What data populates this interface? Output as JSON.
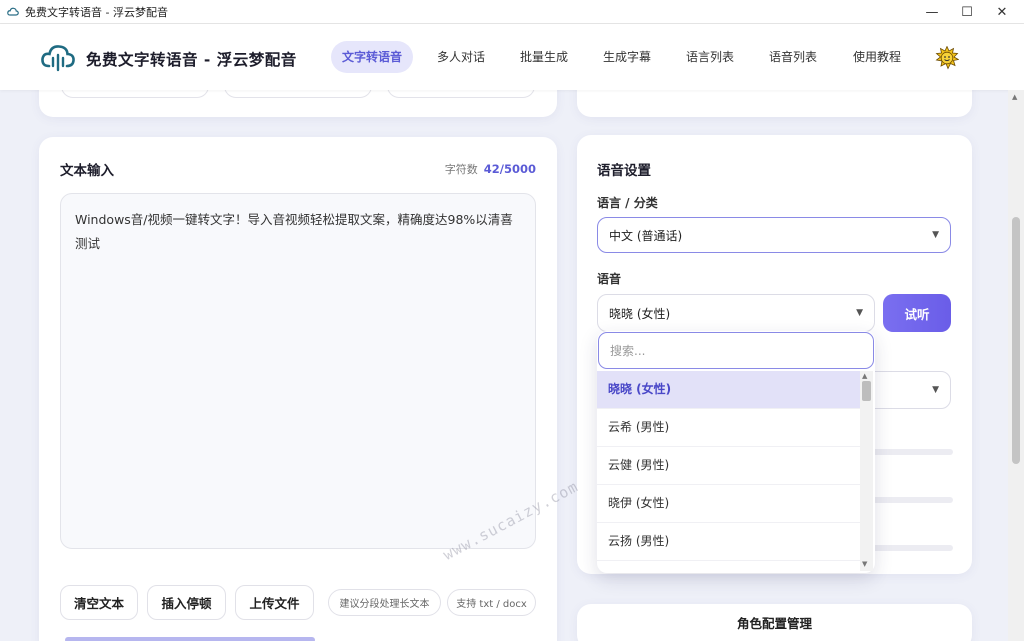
{
  "window": {
    "title": "免费文字转语音 - 浮云梦配音",
    "minimize": "—",
    "maximize": "☐",
    "close": "✕"
  },
  "header": {
    "brand": "免费文字转语音 - 浮云梦配音",
    "nav": [
      {
        "label": "文字转语音",
        "active": true
      },
      {
        "label": "多人对话",
        "active": false
      },
      {
        "label": "批量生成",
        "active": false
      },
      {
        "label": "生成字幕",
        "active": false
      },
      {
        "label": "语言列表",
        "active": false
      },
      {
        "label": "语音列表",
        "active": false
      },
      {
        "label": "使用教程",
        "active": false
      }
    ],
    "theme_icon": "sun-face-icon"
  },
  "text_input": {
    "title": "文本输入",
    "char_count_label": "字符数",
    "char_count_value": "42/5000",
    "content": "Windows音/视频一键转文字！导入音视频轻松提取文案，精确度达98%以清喜测试",
    "buttons": {
      "clear": "清空文本",
      "insert_pause": "插入停顿",
      "upload": "上传文件"
    },
    "hints": {
      "segment": "建议分段处理长文本",
      "formats": "支持 txt / docx"
    }
  },
  "voice_settings": {
    "title": "语音设置",
    "language_label": "语言 / 分类",
    "language_value": "中文 (普通话)",
    "voice_label": "语音",
    "voice_value": "晓晓 (女性)",
    "listen_button": "试听",
    "search_placeholder": "搜索...",
    "options": [
      {
        "label": "晓晓 (女性)",
        "selected": true
      },
      {
        "label": "云希 (男性)",
        "selected": false
      },
      {
        "label": "云健 (男性)",
        "selected": false
      },
      {
        "label": "晓伊 (女性)",
        "selected": false
      },
      {
        "label": "云扬 (男性)",
        "selected": false
      }
    ]
  },
  "role_config": {
    "label": "角色配置管理"
  },
  "watermark": "www.sucaizy.com",
  "colors": {
    "accent": "#5b5bd6",
    "accent_bg": "#e6e6fb",
    "button_gradient_start": "#7a6ff0",
    "page_bg": "#eef0f8"
  }
}
